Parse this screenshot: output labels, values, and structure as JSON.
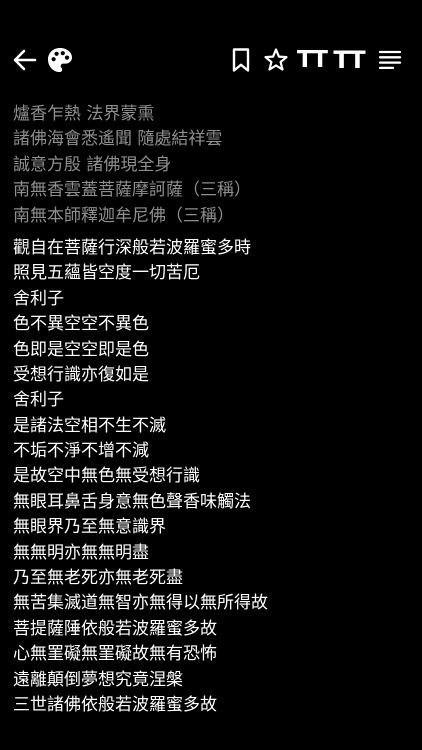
{
  "toolbar": {
    "icons": {
      "back": "arrow-left-icon",
      "theme": "palette-icon",
      "bookmark": "bookmark-icon",
      "favorite": "star-icon",
      "decrease_font": "text-size-decrease-icon",
      "increase_font": "text-size-increase-icon",
      "contents": "list-icon"
    },
    "font_small_label": "TT",
    "font_large_label": "TT"
  },
  "colors": {
    "background": "#000000",
    "text": "#ffffff",
    "preface_text": "#8e8e8e"
  },
  "preface": [
    "爐香乍熱 法界蒙熏",
    "諸佛海會悉遙聞 隨處結祥雲",
    "誠意方殷 諸佛現全身",
    "南無香雲蓋菩薩摩訶薩（三稱）",
    "南無本師釋迦牟尼佛（三稱）"
  ],
  "sutra": [
    "觀自在菩薩行深般若波羅蜜多時",
    "照見五蘊皆空度一切苦厄",
    "舍利子",
    "色不異空空不異色",
    "色即是空空即是色",
    "受想行識亦復如是",
    "舍利子",
    "是諸法空相不生不滅",
    "不垢不淨不增不減",
    "是故空中無色無受想行識",
    "無眼耳鼻舌身意無色聲香味觸法",
    "無眼界乃至無意識界",
    "無無明亦無無明盡",
    "乃至無老死亦無老死盡",
    "無苦集滅道無智亦無得以無所得故",
    "菩提薩陲依般若波羅蜜多故",
    "心無罣礙無罣礙故無有恐怖",
    "遠離顛倒夢想究竟涅槃",
    "三世諸佛依般若波羅蜜多故"
  ]
}
